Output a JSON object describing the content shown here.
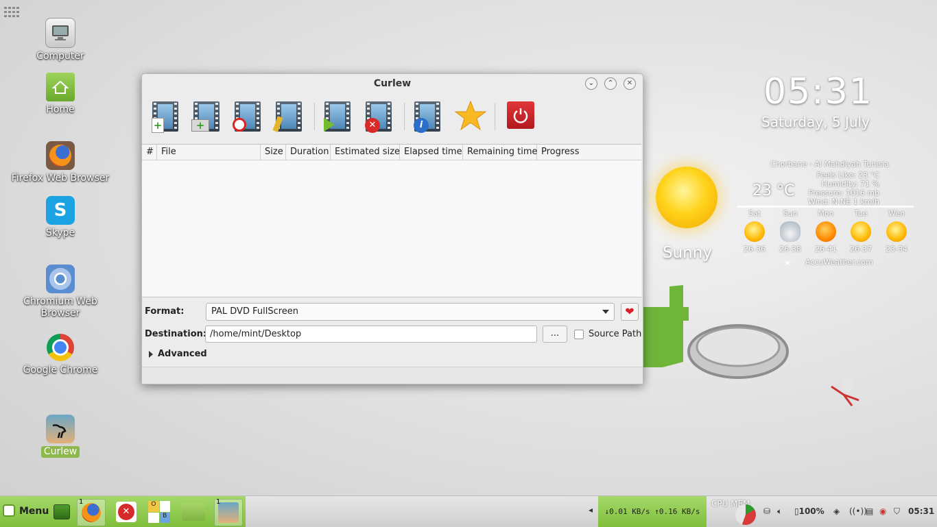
{
  "desktop": {
    "icons": [
      {
        "label": "Computer"
      },
      {
        "label": "Home"
      },
      {
        "label": "Firefox Web Browser"
      },
      {
        "label": "Skype"
      },
      {
        "label": "Chromium Web Browser"
      },
      {
        "label": "Google Chrome"
      },
      {
        "label": "Curlew"
      }
    ]
  },
  "clock": {
    "time": "05:31",
    "date": "Saturday, 5 July"
  },
  "weather": {
    "condition": "Sunny",
    "location": "Chorbane - Al Mahdiyah Tunisia",
    "temperature": "23 °C",
    "feels_like": "Feels Like: 23 °C",
    "humidity": "Humidity: 71 %",
    "pressure": "Pressure: 1016 mb",
    "wind": "Wind: N-NE 1 km/h",
    "forecast": [
      {
        "day": "Sat",
        "range": "26-36",
        "icon": "sun-icon"
      },
      {
        "day": "Sun",
        "range": "26-38",
        "icon": "cloud-icon"
      },
      {
        "day": "Mon",
        "range": "26-41",
        "icon": "hot-sun-icon"
      },
      {
        "day": "Tue",
        "range": "26-37",
        "icon": "sun-icon"
      },
      {
        "day": "Wen",
        "range": "23-34",
        "icon": "sun-icon"
      }
    ],
    "source": "AccuWeather.com"
  },
  "window": {
    "title": "Curlew",
    "table": {
      "columns": [
        "#",
        "File",
        "Size",
        "Duration",
        "Estimated size",
        "Elapsed time",
        "Remaining time",
        "Progress"
      ],
      "rows": []
    },
    "form": {
      "format_label": "Format:",
      "format_value": "PAL DVD FullScreen",
      "destination_label": "Destination:",
      "destination_value": "/home/mint/Desktop",
      "browse_label": "...",
      "source_path_label": "Source Path",
      "advanced_label": "Advanced"
    }
  },
  "panel": {
    "menu_label": "Menu",
    "net_speed": "↓0.01 KB/s ↑0.16 KB/s",
    "cpu_mem_label": "CPU MEM",
    "battery": "100%",
    "time": "05:31",
    "task_count_firefox": "1",
    "task_count_curlew": "1",
    "accent": "#8fc552"
  }
}
